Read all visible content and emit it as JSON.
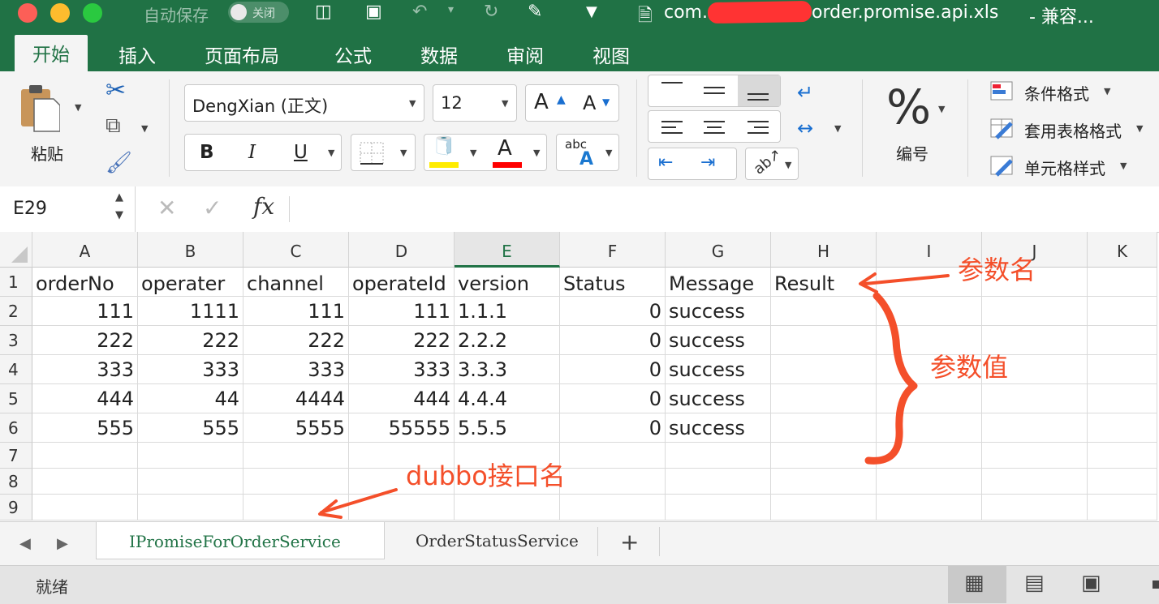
{
  "titlebar": {
    "autosave_label": "自动保存",
    "autosave_state": "关闭",
    "title_prefix": "com.",
    "title_suffix": "order.promise.api.xls",
    "title_tail": "- 兼容..."
  },
  "ribbon_tabs": [
    "开始",
    "插入",
    "页面布局",
    "公式",
    "数据",
    "审阅",
    "视图"
  ],
  "ribbon": {
    "paste_label": "粘贴",
    "font_name": "DengXian (正文)",
    "font_size": "12",
    "number_label": "编号",
    "percent_symbol": "%",
    "conditional_format": "条件格式",
    "table_format": "套用表格格式",
    "cell_styles": "单元格样式",
    "bold": "B",
    "italic": "I",
    "underline": "U",
    "grow_font": "A",
    "shrink_font": "A",
    "font_color_letter": "A",
    "abc_label": "abc",
    "abc_a": "A",
    "highlight_color": "#ffec00",
    "font_color": "#ff0000"
  },
  "formula_bar": {
    "name_box": "E29",
    "fx_label": "fx",
    "cancel_symbol": "✕",
    "enter_symbol": "✓"
  },
  "sheet": {
    "columns": [
      "A",
      "B",
      "C",
      "D",
      "E",
      "F",
      "G",
      "H",
      "I",
      "J",
      "K"
    ],
    "selected_column": "E",
    "rows": [
      {
        "n": "1",
        "cells": [
          "orderNo",
          "operater",
          "channel",
          "operateId",
          "version",
          "Status",
          "Message",
          "Result"
        ]
      },
      {
        "n": "2",
        "cells": [
          "111",
          "1111",
          "111",
          "111",
          "1.1.1",
          "0",
          "success",
          ""
        ]
      },
      {
        "n": "3",
        "cells": [
          "222",
          "222",
          "222",
          "222",
          "2.2.2",
          "0",
          "success",
          ""
        ]
      },
      {
        "n": "4",
        "cells": [
          "333",
          "333",
          "333",
          "333",
          "3.3.3",
          "0",
          "success",
          ""
        ]
      },
      {
        "n": "5",
        "cells": [
          "444",
          "44",
          "4444",
          "444",
          "4.4.4",
          "0",
          "success",
          ""
        ]
      },
      {
        "n": "6",
        "cells": [
          "555",
          "555",
          "5555",
          "55555",
          "5.5.5",
          "0",
          "success",
          ""
        ]
      },
      {
        "n": "7",
        "cells": [
          "",
          "",
          "",
          "",
          "",
          "",
          "",
          ""
        ]
      },
      {
        "n": "8",
        "cells": [
          "",
          "",
          "",
          "",
          "",
          "",
          "",
          ""
        ]
      },
      {
        "n": "9",
        "cells": [
          "",
          "",
          "",
          "",
          "",
          "",
          "",
          ""
        ]
      }
    ]
  },
  "sheet_tabs": [
    "IPromiseForOrderService",
    "OrderStatusService"
  ],
  "add_sheet": "+",
  "status": {
    "text": "就绪"
  },
  "annotations": {
    "param_name": "参数名",
    "param_value": "参数值",
    "dubbo_interface": "dubbo接口名",
    "color": "#f44f2a"
  }
}
